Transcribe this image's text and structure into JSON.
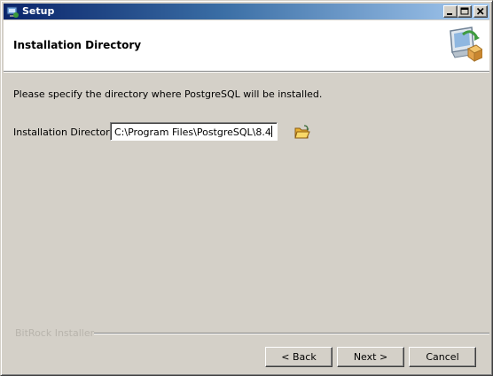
{
  "window": {
    "title": "Setup",
    "controls": [
      "minimize",
      "maximize",
      "close"
    ]
  },
  "header": {
    "title": "Installation Directory",
    "icon": "computer-install-icon"
  },
  "body": {
    "instruction": "Please specify the directory where PostgreSQL will be installed.",
    "directory_label": "Installation Directory",
    "directory_value": "C:\\Program Files\\PostgreSQL\\8.4",
    "browse_icon": "folder-open-icon"
  },
  "footer": {
    "brand": "BitRock Installer",
    "back_label": "< Back",
    "next_label": "Next >",
    "cancel_label": "Cancel"
  }
}
